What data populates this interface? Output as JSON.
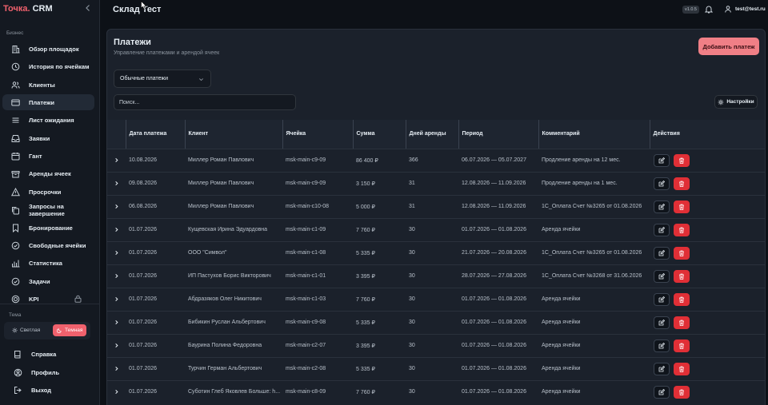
{
  "sidebar": {
    "logo_brand": "Точка.",
    "logo_rest": " CRM",
    "section_business": "Бизнес",
    "items": [
      {
        "label": "Обзор площадок",
        "icon": "building-icon",
        "active": false
      },
      {
        "label": "История по ячейкам",
        "icon": "history-icon",
        "active": false
      },
      {
        "label": "Клиенты",
        "icon": "users-icon",
        "active": false
      },
      {
        "label": "Платежи",
        "icon": "credit-card-icon",
        "active": true
      },
      {
        "label": "Лист ожидания",
        "icon": "list-icon",
        "active": false
      },
      {
        "label": "Заявки",
        "icon": "inbox-icon",
        "active": false
      },
      {
        "label": "Гант",
        "icon": "calendar-icon",
        "active": false
      },
      {
        "label": "Аренды ячеек",
        "icon": "box-icon",
        "active": false
      },
      {
        "label": "Просрочки",
        "icon": "warning-icon",
        "active": false
      },
      {
        "label": "Запросы на завершение",
        "icon": "copy-icon",
        "active": false
      },
      {
        "label": "Бронирование",
        "icon": "bookmark-icon",
        "active": false
      },
      {
        "label": "Свободные ячейки",
        "icon": "circle-check-icon",
        "active": false
      },
      {
        "label": "Статистика",
        "icon": "bar-chart-icon",
        "active": false
      },
      {
        "label": "Задачи",
        "icon": "check-circle-icon",
        "active": false
      },
      {
        "label": "KPI",
        "icon": "target-icon",
        "active": false
      }
    ],
    "section_theme": "Тема",
    "theme_light": "Светлая",
    "theme_dark": "Темная",
    "bottom": [
      {
        "label": "Справка",
        "icon": "book-icon"
      },
      {
        "label": "Профиль",
        "icon": "user-circle-icon"
      },
      {
        "label": "Выход",
        "icon": "logout-icon"
      }
    ]
  },
  "topbar": {
    "title": "Склад Тест",
    "version": "v1.0.5",
    "user_email": "test@test.ru"
  },
  "page": {
    "title": "Платежи",
    "subtitle": "Управление платежами и арендой ячеек",
    "add_button": "Добавить платеж",
    "payment_type": "Обычные платежи",
    "search_placeholder": "Поиск...",
    "settings_button": "Настройки"
  },
  "table": {
    "columns": [
      "Дата платежа",
      "Клиент",
      "Ячейка",
      "Сумма",
      "Дней аренды",
      "Период",
      "Комментарий",
      "Действия"
    ],
    "rows": [
      {
        "date": "10.08.2026",
        "client": "Миллер Роман Павлович",
        "cell": "msk-main-c9-09",
        "sum": "86 400 ₽",
        "days": "366",
        "period": "06.07.2026 — 05.07.2027",
        "comment": "Продление аренды на 12 мес."
      },
      {
        "date": "09.08.2026",
        "client": "Миллер Роман Павлович",
        "cell": "msk-main-c9-09",
        "sum": "3 150 ₽",
        "days": "31",
        "period": "12.08.2026 — 11.09.2026",
        "comment": "Продление аренды на 1 мес."
      },
      {
        "date": "06.08.2026",
        "client": "Миллер Роман Павлович",
        "cell": "msk-main-c10-08",
        "sum": "5 000 ₽",
        "days": "31",
        "period": "12.08.2026 — 11.09.2026",
        "comment": "1С_Оплата Счет №3265 от 01.08.2026"
      },
      {
        "date": "01.07.2026",
        "client": "Кущевская Ирина Эдуардовна",
        "cell": "msk-main-c1-09",
        "sum": "7 760 ₽",
        "days": "30",
        "period": "01.07.2026 — 01.08.2026",
        "comment": "Аренда ячейки"
      },
      {
        "date": "01.07.2026",
        "client": "ООО \"Символ\"",
        "cell": "msk-main-c1-08",
        "sum": "5 335 ₽",
        "days": "30",
        "period": "21.07.2026 — 20.08.2026",
        "comment": "1С_Оплата Счет №3265 от 01.08.2026"
      },
      {
        "date": "01.07.2026",
        "client": "ИП Пастухов Борис Викторович",
        "cell": "msk-main-c1-01",
        "sum": "3 395 ₽",
        "days": "30",
        "period": "28.07.2026 — 27.08.2026",
        "comment": "1С_Оплата Счет №3268 от 31.06.2026"
      },
      {
        "date": "01.07.2026",
        "client": "Абдразяков Олег Никитович",
        "cell": "msk-main-c1-03",
        "sum": "7 760 ₽",
        "days": "30",
        "period": "01.07.2026 — 01.08.2026",
        "comment": "Аренда ячейки"
      },
      {
        "date": "01.07.2026",
        "client": "Бибикин Руслан Альбертович",
        "cell": "msk-main-c9-08",
        "sum": "5 335 ₽",
        "days": "30",
        "period": "01.07.2026 — 01.08.2026",
        "comment": "Аренда ячейки"
      },
      {
        "date": "01.07.2026",
        "client": "Баурина Полина Федоровна",
        "cell": "msk-main-c2-07",
        "sum": "3 395 ₽",
        "days": "30",
        "period": "01.07.2026 — 01.08.2026",
        "comment": "Аренда ячейки"
      },
      {
        "date": "01.07.2026",
        "client": "Турчин Герман Альбертович",
        "cell": "msk-main-c2-08",
        "sum": "5 335 ₽",
        "days": "30",
        "period": "01.07.2026 — 01.08.2026",
        "comment": "Аренда ячейки"
      },
      {
        "date": "01.07.2026",
        "client": "Суботин Глеб Яковлев Больше: h...",
        "cell": "msk-main-c8-09",
        "sum": "7 760 ₽",
        "days": "30",
        "period": "01.07.2026 — 01.08.2026",
        "comment": "Аренда ячейки"
      }
    ]
  },
  "colors": {
    "accent": "#f0616d",
    "danger": "#e02f36",
    "background": "#0d1117",
    "panel": "#1b212b"
  }
}
